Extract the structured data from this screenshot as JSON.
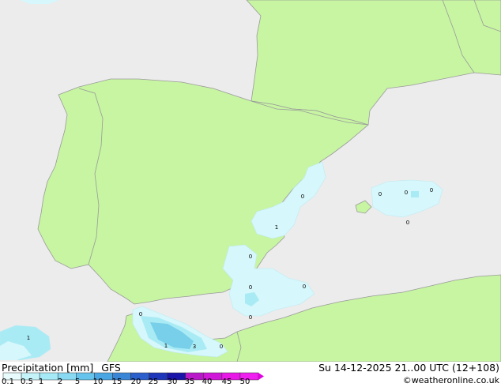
{
  "colors": {
    "sea": "#ececec",
    "land": "#c7f5a2",
    "border": "#9a9a9a",
    "precip_light": "#d6f7fb",
    "precip_mid": "#a9ebf5",
    "precip_strong": "#78cfe9",
    "legend_arrow": "#e000e0"
  },
  "footer": {
    "title": "Precipitation [mm]",
    "model": "GFS",
    "valid_time": "Su 14-12-2025 21..00 UTC (12+108)",
    "credit": "©weatheronline.co.uk"
  },
  "legend": {
    "ticks": [
      "0.1",
      "0.5",
      "1",
      "2",
      "5",
      "10",
      "15",
      "20",
      "25",
      "30",
      "35",
      "40",
      "45",
      "50"
    ],
    "colors": [
      "#e8fcfd",
      "#c4f3fa",
      "#a6eaf7",
      "#8ad9f2",
      "#66c3ec",
      "#4aa6e2",
      "#3a86d6",
      "#2b5fcb",
      "#1e36ba",
      "#1a14a8",
      "#b818c8",
      "#d018d8",
      "#e818e6",
      "#f020f0"
    ]
  },
  "map_labels": [
    {
      "text": "0"
    },
    {
      "text": "1"
    },
    {
      "text": "0"
    },
    {
      "text": "0"
    },
    {
      "text": "0"
    },
    {
      "text": "0"
    },
    {
      "text": "0"
    },
    {
      "text": "0"
    },
    {
      "text": "0"
    },
    {
      "text": "0"
    },
    {
      "text": "0"
    },
    {
      "text": "0"
    },
    {
      "text": "1"
    },
    {
      "text": "1"
    },
    {
      "text": "3"
    },
    {
      "text": "0"
    }
  ]
}
